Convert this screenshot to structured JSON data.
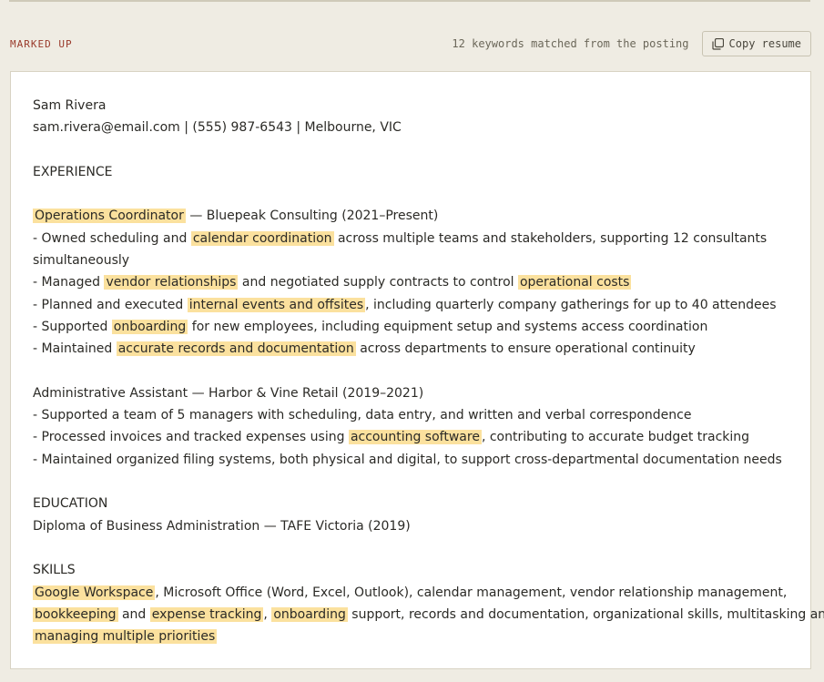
{
  "header": {
    "section_label": "MARKED UP",
    "match_count": "12 keywords matched from the posting",
    "copy_button_label": "Copy resume",
    "copy_icon": "copy-icon"
  },
  "colors": {
    "page_bg": "#efece3",
    "card_bg": "#ffffff",
    "accent_label": "#9a3b2c",
    "highlight": "#fbe19e"
  },
  "resume": {
    "name": "Sam Rivera",
    "contact": "sam.rivera@email.com | (555) 987-6543 | Melbourne, VIC",
    "experience_heading": "EXPERIENCE",
    "job1": {
      "title": "Operations Coordinator",
      "company": " — Bluepeak Consulting (2021–Present)",
      "b1_pre": "- Owned scheduling and ",
      "b1_kw": "calendar coordination",
      "b1_post": " across multiple teams and stakeholders, supporting 12 consultants simultaneously",
      "b2_pre": "- Managed ",
      "b2_kw1": "vendor relationships",
      "b2_mid": " and negotiated supply contracts to control ",
      "b2_kw2": "operational costs",
      "b3_pre": "- Planned and executed ",
      "b3_kw": "internal events and offsites",
      "b3_post": ", including quarterly company gatherings for up to 40 attendees",
      "b4_pre": "- Supported ",
      "b4_kw": "onboarding",
      "b4_post": " for new employees, including equipment setup and systems access coordination",
      "b5_pre": "- Maintained ",
      "b5_kw": "accurate records and documentation",
      "b5_post": " across departments to ensure operational continuity"
    },
    "job2": {
      "header": "Administrative Assistant — Harbor & Vine Retail (2019–2021)",
      "b1": "- Supported a team of 5 managers with scheduling, data entry, and written and verbal correspondence",
      "b2_pre": "- Processed invoices and tracked expenses using ",
      "b2_kw": "accounting software",
      "b2_post": ", contributing to accurate budget tracking",
      "b3": "- Maintained organized filing systems, both physical and digital, to support cross-departmental documentation needs"
    },
    "education_heading": "EDUCATION",
    "education": "Diploma of Business Administration — TAFE Victoria (2019)",
    "skills_heading": "SKILLS",
    "skills": {
      "kw1": "Google Workspace",
      "t1": ", Microsoft Office (Word, Excel, Outlook), calendar management, vendor relationship management,",
      "kw2": "bookkeeping",
      "t2": " and ",
      "kw3": "expense tracking",
      "t3": ", ",
      "kw4": "onboarding",
      "t4": " support, records and documentation, organizational skills, multitasking and",
      "kw5": "managing multiple priorities"
    }
  }
}
